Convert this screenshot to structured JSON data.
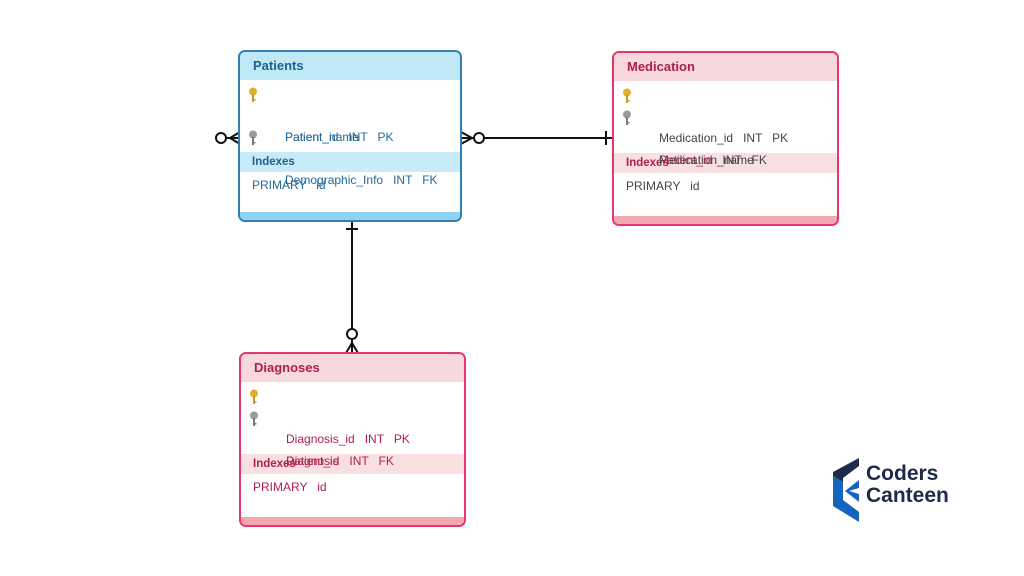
{
  "tables": {
    "patients": {
      "title": "Patients",
      "columns": [
        {
          "text": "Patient_id   INT   PK",
          "icon": "primary-key-icon"
        },
        {
          "text": "Patient_name",
          "icon": ""
        },
        {
          "text": "Demographic_Info   INT   FK",
          "icon": "foreign-key-icon"
        }
      ],
      "indexes_label": "Indexes",
      "indexes": [
        "PRIMARY   id"
      ]
    },
    "medication": {
      "title": "Medication",
      "columns": [
        {
          "text": "Medication_id   INT   PK",
          "icon": "primary-key-icon"
        },
        {
          "text": "Patient_id",
          "suffix": "   INT   FK",
          "icon": "foreign-key-icon"
        },
        {
          "text": "Medication_name",
          "icon": ""
        }
      ],
      "indexes_label": "Indexes",
      "indexes": [
        "PRIMARY   id"
      ]
    },
    "diagnoses": {
      "title": "Diagnoses",
      "columns": [
        {
          "text": "Diagnosis_id   INT   PK",
          "icon": "primary-key-icon"
        },
        {
          "text": "Patient_id   INT   FK",
          "icon": "foreign-key-icon"
        },
        {
          "text": "Diagnosis",
          "icon": ""
        }
      ],
      "indexes_label": "Indexes",
      "indexes": [
        "PRIMARY   id"
      ]
    }
  },
  "relationships": [
    {
      "from": "Patients",
      "to": "Medication",
      "from_end": "zero-or-many",
      "to_end": "one"
    },
    {
      "from": "Patients",
      "to": "Diagnoses",
      "from_end": "one",
      "to_end": "zero-or-many"
    },
    {
      "from": "Patients",
      "to": "external-left",
      "from_end": "zero-or-many",
      "to_end": ""
    }
  ],
  "logo": {
    "line1": "Coders",
    "line2": "Canteen"
  },
  "colors": {
    "blue_border": "#2f7fb8",
    "pink_border": "#e8356a",
    "key_gold": "#e0b030",
    "key_gray": "#8a8a8a",
    "logo_dark": "#1e2a4a",
    "logo_blue": "#1565c0"
  }
}
